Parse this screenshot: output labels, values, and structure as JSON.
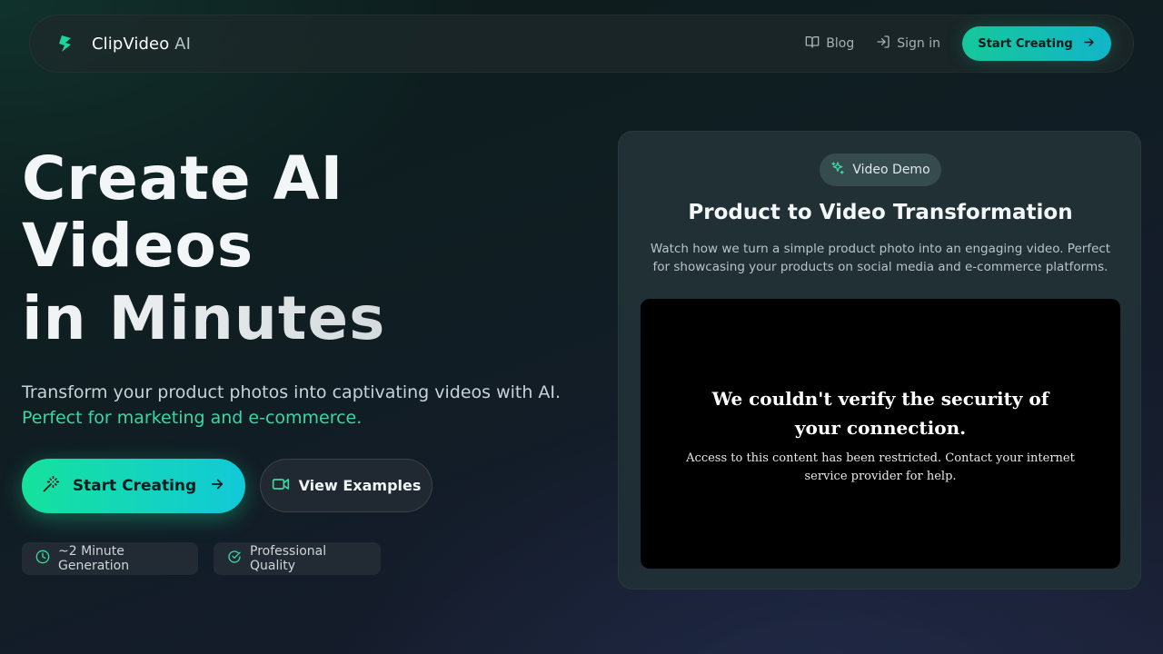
{
  "navbar": {
    "brand_name": "ClipVideo",
    "brand_suffix": " AI",
    "brand_icon": "lightning-s-logo-icon",
    "links": [
      {
        "label": "Blog",
        "icon": "book-open-icon"
      },
      {
        "label": "Sign in",
        "icon": "log-in-icon"
      }
    ],
    "cta_label": "Start Creating"
  },
  "hero": {
    "title_line1": "Create AI",
    "title_line2": "Videos",
    "title_line3": "in Minutes",
    "subtitle": "Transform your product photos into captivating videos with AI.",
    "subtitle_accent": "Perfect for marketing and e-commerce.",
    "primary_button": "Start Creating",
    "secondary_button": "View Examples",
    "features": [
      {
        "label": "~2 Minute Generation",
        "icon": "clock-icon"
      },
      {
        "label": "Professional Quality",
        "icon": "badge-check-icon"
      }
    ]
  },
  "demo": {
    "badge": "Video Demo",
    "title": "Product to Video Transformation",
    "description": "Watch how we turn a simple product photo into an engaging video. Perfect for showcasing your products on social media and e-commerce platforms.",
    "video_error_title": "We couldn't verify the security of your connection.",
    "video_error_body": "Access to this content has been restricted. Contact your internet service provider for help."
  },
  "colors": {
    "accent_green": "#15e29c",
    "accent_cyan": "#12c9d8",
    "accent_text": "#3dd6a3",
    "background": "#0f1e21"
  }
}
